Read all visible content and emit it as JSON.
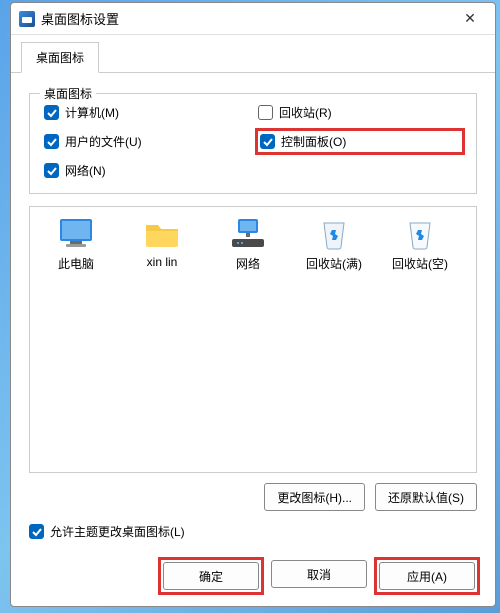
{
  "window": {
    "title": "桌面图标设置",
    "close_x": "✕"
  },
  "tab": {
    "label": "桌面图标"
  },
  "group": {
    "title": "桌面图标",
    "items": {
      "computer": {
        "label": "计算机(M)",
        "checked": true
      },
      "recycle": {
        "label": "回收站(R)",
        "checked": false
      },
      "userfiles": {
        "label": "用户的文件(U)",
        "checked": true
      },
      "control": {
        "label": "控制面板(O)",
        "checked": true
      },
      "network": {
        "label": "网络(N)",
        "checked": true
      }
    }
  },
  "icons": {
    "thispc": "此电脑",
    "xinlin": "xin lin",
    "network": "网络",
    "binfull": "回收站(满)",
    "binempty": "回收站(空)"
  },
  "buttons": {
    "changeicon": "更改图标(H)...",
    "restore": "还原默认值(S)",
    "ok": "确定",
    "cancel": "取消",
    "apply": "应用(A)"
  },
  "theme_checkbox": {
    "label": "允许主题更改桌面图标(L)",
    "checked": true
  }
}
